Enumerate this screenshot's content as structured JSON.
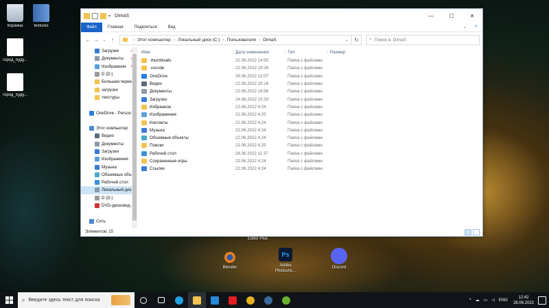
{
  "desktop": {
    "icons": [
      {
        "label": "Корзина"
      },
      {
        "label": "textures"
      },
      {
        "label": "город_буду..."
      },
      {
        "label": "город_буду..."
      }
    ],
    "apps": [
      {
        "label": "Blender"
      },
      {
        "label": "Adobe Photosho..."
      },
      {
        "label": "Discord"
      }
    ],
    "editor_label": "Editor Plus",
    "ps_glyph": "Ps"
  },
  "window": {
    "title": "DimaS",
    "controls": {
      "minimize": "—",
      "maximize": "☐",
      "close": "✕"
    },
    "ribbon": {
      "file": "Файл",
      "tabs": [
        "Главная",
        "Поделиться",
        "Вид"
      ],
      "help": "?"
    },
    "address": {
      "path": [
        "Этот компьютер",
        "Локальный диск (C:)",
        "Пользователи",
        "DimaS"
      ],
      "search_placeholder": "Поиск в: DimaS"
    },
    "nav": [
      {
        "label": "Загрузки",
        "pinned": true,
        "color": "#3a7bd5"
      },
      {
        "label": "Документы",
        "pinned": true,
        "color": "#8a9aaa"
      },
      {
        "label": "Изображени",
        "pinned": true,
        "color": "#5aa0d8"
      },
      {
        "label": "D (D:)",
        "pinned": false,
        "color": "#999999"
      },
      {
        "label": "Большая перем",
        "pinned": false,
        "color": "#f2c24f"
      },
      {
        "label": "загрузки",
        "pinned": false,
        "color": "#f2c24f"
      },
      {
        "label": "текстуры",
        "pinned": false,
        "color": "#f2c24f"
      },
      {
        "label": "",
        "pinned": false,
        "color": ""
      },
      {
        "label": "OneDrive - Person",
        "pinned": false,
        "color": "#2a7de1"
      },
      {
        "label": "",
        "pinned": false,
        "color": ""
      },
      {
        "label": "Этот компьютер",
        "pinned": false,
        "color": "#4a8ad0"
      },
      {
        "label": "Видео",
        "pinned": false,
        "color": "#5a6b7c"
      },
      {
        "label": "Документы",
        "pinned": false,
        "color": "#8a9aaa"
      },
      {
        "label": "Загрузки",
        "pinned": false,
        "color": "#3a7bd5"
      },
      {
        "label": "Изображения",
        "pinned": false,
        "color": "#5aa0d8"
      },
      {
        "label": "Музыка",
        "pinned": false,
        "color": "#3a7bd5"
      },
      {
        "label": "Объемные объе",
        "pinned": false,
        "color": "#4aa8c8"
      },
      {
        "label": "Рабочий стол",
        "pinned": false,
        "color": "#3a8fd8"
      },
      {
        "label": "Локальный дис",
        "pinned": false,
        "color": "#8a9aaa",
        "selected": true
      },
      {
        "label": "D (D:)",
        "pinned": false,
        "color": "#999999"
      },
      {
        "label": "DVD-дисковод (",
        "pinned": false,
        "color": "#cc3333"
      },
      {
        "label": "",
        "pinned": false,
        "color": ""
      },
      {
        "label": "Сеть",
        "pinned": false,
        "color": "#4a8ad0"
      }
    ],
    "columns": {
      "name": "Имя",
      "date": "Дата изменения",
      "type": "Тип",
      "size": "Размер"
    },
    "files": [
      {
        "name": ".thumbnails",
        "date": "22.06.2022 14:55",
        "type": "Папка с файлами",
        "color": "#f2c24f"
      },
      {
        "name": ".vscode",
        "date": "22.06.2022 19:26",
        "type": "Папка с файлами",
        "color": "#f2c24f"
      },
      {
        "name": "OneDrive",
        "date": "28.06.2022 12:07",
        "type": "Папка с файлами",
        "color": "#2a7de1"
      },
      {
        "name": "Видео",
        "date": "22.06.2022 19:16",
        "type": "Папка с файлами",
        "color": "#5a6b7c"
      },
      {
        "name": "Документы",
        "date": "22.06.2022 18:56",
        "type": "Папка с файлами",
        "color": "#8a9aaa"
      },
      {
        "name": "Загрузки",
        "date": "24.06.2022 23:33",
        "type": "Папка с файлами",
        "color": "#3a7bd5"
      },
      {
        "name": "Избранное",
        "date": "22.06.2022 4:24",
        "type": "Папка с файлами",
        "color": "#f2c24f"
      },
      {
        "name": "Изображения",
        "date": "22.06.2022 4:25",
        "type": "Папка с файлами",
        "color": "#5aa0d8"
      },
      {
        "name": "Контакты",
        "date": "22.06.2022 4:24",
        "type": "Папка с файлами",
        "color": "#f2c24f"
      },
      {
        "name": "Музыка",
        "date": "22.06.2022 4:24",
        "type": "Папка с файлами",
        "color": "#3a7bd5"
      },
      {
        "name": "Объемные объекты",
        "date": "22.06.2022 4:24",
        "type": "Папка с файлами",
        "color": "#4aa8c8"
      },
      {
        "name": "Поиски",
        "date": "22.06.2022 4:25",
        "type": "Папка с файлами",
        "color": "#f2c24f"
      },
      {
        "name": "Рабочий стол",
        "date": "28.06.2022 11:37",
        "type": "Папка с файлами",
        "color": "#3a8fd8"
      },
      {
        "name": "Сохраненные игры",
        "date": "22.06.2022 4:24",
        "type": "Папка с файлами",
        "color": "#f2c24f"
      },
      {
        "name": "Ссылки",
        "date": "22.06.2022 4:24",
        "type": "Папка с файлами",
        "color": "#3a7bd5"
      }
    ],
    "status": "Элементов: 15"
  },
  "taskbar": {
    "search_placeholder": "Введите здесь текст для поиска",
    "pinned": [
      {
        "name": "cortana-icon",
        "color": "#ffffff"
      },
      {
        "name": "task-view-icon",
        "color": "#ffffff"
      },
      {
        "name": "edge-icon",
        "color": "#1fa0e0"
      },
      {
        "name": "file-explorer-icon",
        "color": "#f2c24f",
        "active": true
      },
      {
        "name": "mail-icon",
        "color": "#2a88d8"
      },
      {
        "name": "youtube-icon",
        "color": "#e02020"
      },
      {
        "name": "chrome-icon",
        "color": "#e8b020"
      },
      {
        "name": "steam-icon",
        "color": "#3a6a9a"
      },
      {
        "name": "utorrent-icon",
        "color": "#6ab030"
      }
    ],
    "tray": {
      "arrow": "^",
      "lang": "ENG",
      "time": "12:42",
      "date": "28.06.2022"
    }
  }
}
